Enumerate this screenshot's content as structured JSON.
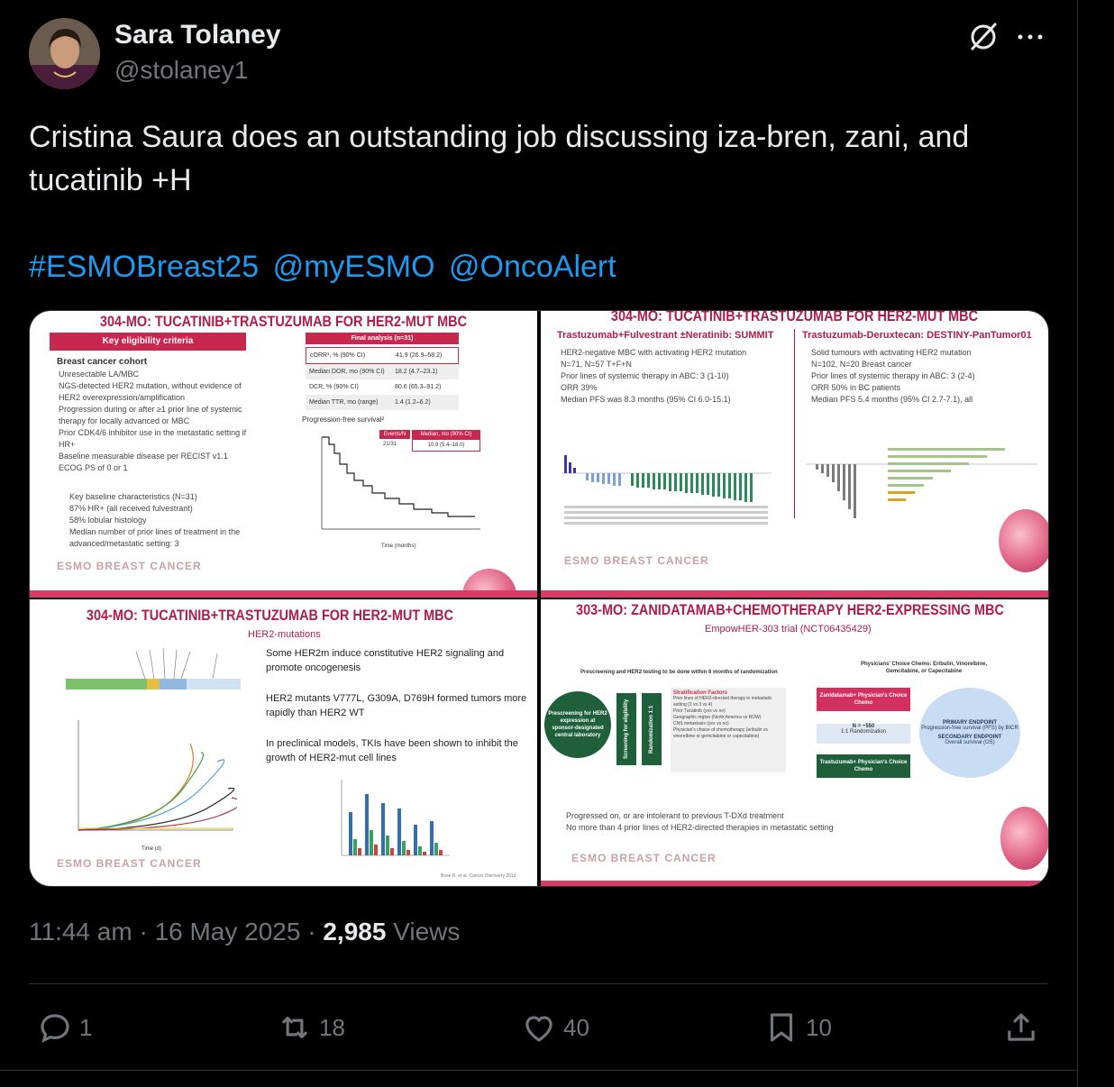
{
  "author": {
    "name": "Sara Tolaney",
    "handle": "@stolaney1"
  },
  "tweet": {
    "text": "Cristina Saura does an outstanding job discussing iza-bren, zani, and tucatinib +H",
    "hashtags": [
      "#ESMOBreast25",
      "@myESMO",
      "@OncoAlert"
    ]
  },
  "media": {
    "slide1": {
      "title": "304-MO: TUCATINIB+TRASTUZUMAB FOR HER2-MUT MBC",
      "criteria_header": "Key eligibility criteria",
      "cohort": "Breast cancer cohort",
      "bullets": [
        "Unresectable LA/MBC",
        "NGS-detected HER2 mutation, without evidence of HER2 overexpression/amplification",
        "Progression during or after ≥1 prior line of systemic therapy for locally advanced or MBC",
        "Prior CDK4/6 inhibitor use in the metastatic setting if HR+",
        "Baseline measurable disease per RECIST v1.1",
        "ECOG PS of 0 or 1"
      ],
      "baseline_header": "Key baseline characteristics (N=31)",
      "baseline": [
        "87% HR+ (all received fulvestrant)",
        "58% lobular histology",
        "Median number of prior lines of treatment in the advanced/metastatic setting: 3"
      ],
      "table_header": "Final analysis (n=31)",
      "table_rows": [
        [
          "cORR¹, % (90% CI)",
          "41.9 (26.9–58.2)"
        ],
        [
          "Median DOR, mo (90% CI)",
          "18.2 (4.7–23.1)"
        ],
        [
          "DCR, % (90% CI)",
          "80.6 (65.3–91.2)"
        ],
        [
          "Median TTR, mo (range)",
          "1.4 (1.2–6.2)"
        ]
      ],
      "pfs_label": "Progression-free survival²",
      "events_header": "Events/N",
      "median_header": "Median, mo (90% CI)",
      "events_value": "21/31",
      "median_value": "10.9 (5.4–18.0)",
      "xaxis": "Time (months)",
      "logo": "ESMO BREAST CANCER"
    },
    "slide2": {
      "title": "304-MO: TUCATINIB+TRASTUZUMAB FOR HER2-MUT MBC",
      "left_header": "Trastuzumab+Fulvestrant ±Neratinib: SUMMIT",
      "left_bullets": [
        "HER2-negative MBC with activating HER2 mutation",
        "N=71, N=57 T+F+N",
        "Prior lines of systemic therapy in ABC: 3 (1-10)",
        "ORR 39%",
        "Median PFS was 8.3 months (95% CI 6.0-15.1)"
      ],
      "right_header": "Trastuzumab-Deruxtecan: DESTINY-PanTumor01",
      "right_bullets": [
        "Solid tumours with activating HER2 mutation",
        "N=102, N=20 Breast cancer",
        "Prior lines of systemic therapy in ABC: 3 (2-4)",
        "ORR 50% in BC patients",
        "Median PFS 5.4 months (95% CI 2.7-7.1), all"
      ],
      "logo": "ESMO BREAST CANCER"
    },
    "slide3": {
      "title": "304-MO: TUCATINIB+TRASTUZUMAB FOR HER2-MUT MBC",
      "subheader": "HER2-mutations",
      "bullets": [
        "Some HER2m induce constitutive HER2 signaling and promote oncogenesis",
        "HER2 mutants V777L, G309A, D769H formed tumors more rapidly than HER2 WT",
        "In preclinical models, TKIs have been shown to inhibit the growth of HER2-mut cell lines"
      ],
      "xaxis": "Time (d)",
      "citation": "Bose R, et al. Cancer Discovery 2013",
      "logo": "ESMO BREAST CANCER"
    },
    "slide4": {
      "title": "303-MO: ZANIDATAMAB+CHEMOTHERAPY HER2-EXPRESSING MBC",
      "trial": "EmpowHER-303 trial (NCT06435429)",
      "prescreen_note": "Prescreening and HER2 testing to be done within 6 months of randomization",
      "chemo_note": "Physicians' Choice Chemo: Eribulin, Vinorelbine, Gemcitabine, or Capecitabine",
      "circle": "Prescreening for HER2 expression at sponsor-designated central laboratory",
      "screen_box": "Screening for eligibility",
      "rand_box": "Randomization 1:1",
      "strat_header": "Stratification Factors",
      "strat_items": [
        "Prior lines of HER2-directed therapy in metastatic setting (2 vs 3 vs 4)",
        "Prior Tucatinib (yes vs no)",
        "Geographic region (North America vs ROW)",
        "CNS metastasis (yes vs no)",
        "Physician's choice of chemotherapy (eribulin vs vinorelbine or gemcitabine or capecitabine)"
      ],
      "arm1": "Zanidatamab+ Physician's Choice Chemo",
      "arm2": "Trastuzumab+ Physician's Choice Chemo",
      "n_label": "N = ~550",
      "rand_label": "1:1 Randomization",
      "primary": "PRIMARY ENDPOINT",
      "primary_desc": "Progression-free survival (PFS) by BICR",
      "secondary": "SECONDARY ENDPOINT",
      "secondary_desc": "Overall survival (OS)",
      "bullets": [
        "Progressed on, or are intolerant to previous T-DXd treatment",
        "No more than 4 prior lines of HER2-directed therapies in metastatic setting"
      ],
      "logo": "ESMO BREAST CANCER"
    }
  },
  "meta": {
    "time": "11:44 am",
    "date": "16 May 2025",
    "views_count": "2,985",
    "views_label": "Views"
  },
  "actions": {
    "replies": "1",
    "reposts": "18",
    "likes": "40",
    "bookmarks": "10"
  }
}
